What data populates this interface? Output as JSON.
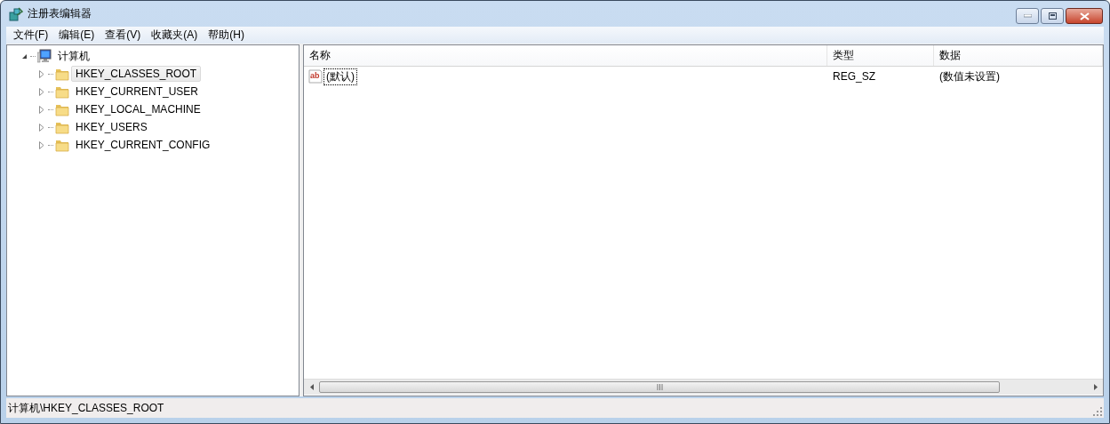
{
  "window": {
    "title": "注册表编辑器"
  },
  "menu": [
    "文件(F)",
    "编辑(E)",
    "查看(V)",
    "收藏夹(A)",
    "帮助(H)"
  ],
  "tree": {
    "label": "计算机",
    "expanded": true,
    "selected": false,
    "children": [
      {
        "label": "HKEY_CLASSES_ROOT",
        "expanded": false,
        "selected": true
      },
      {
        "label": "HKEY_CURRENT_USER",
        "expanded": false,
        "selected": false
      },
      {
        "label": "HKEY_LOCAL_MACHINE",
        "expanded": false,
        "selected": false
      },
      {
        "label": "HKEY_USERS",
        "expanded": false,
        "selected": false
      },
      {
        "label": "HKEY_CURRENT_CONFIG",
        "expanded": false,
        "selected": false
      }
    ]
  },
  "table": {
    "columns": [
      "名称",
      "类型",
      "数据"
    ],
    "rows": [
      {
        "icon_text": "ab",
        "name": "(默认)",
        "type": "REG_SZ",
        "data": "(数值未设置)",
        "focused": true
      }
    ]
  },
  "status_bar": "计算机\\HKEY_CLASSES_ROOT"
}
